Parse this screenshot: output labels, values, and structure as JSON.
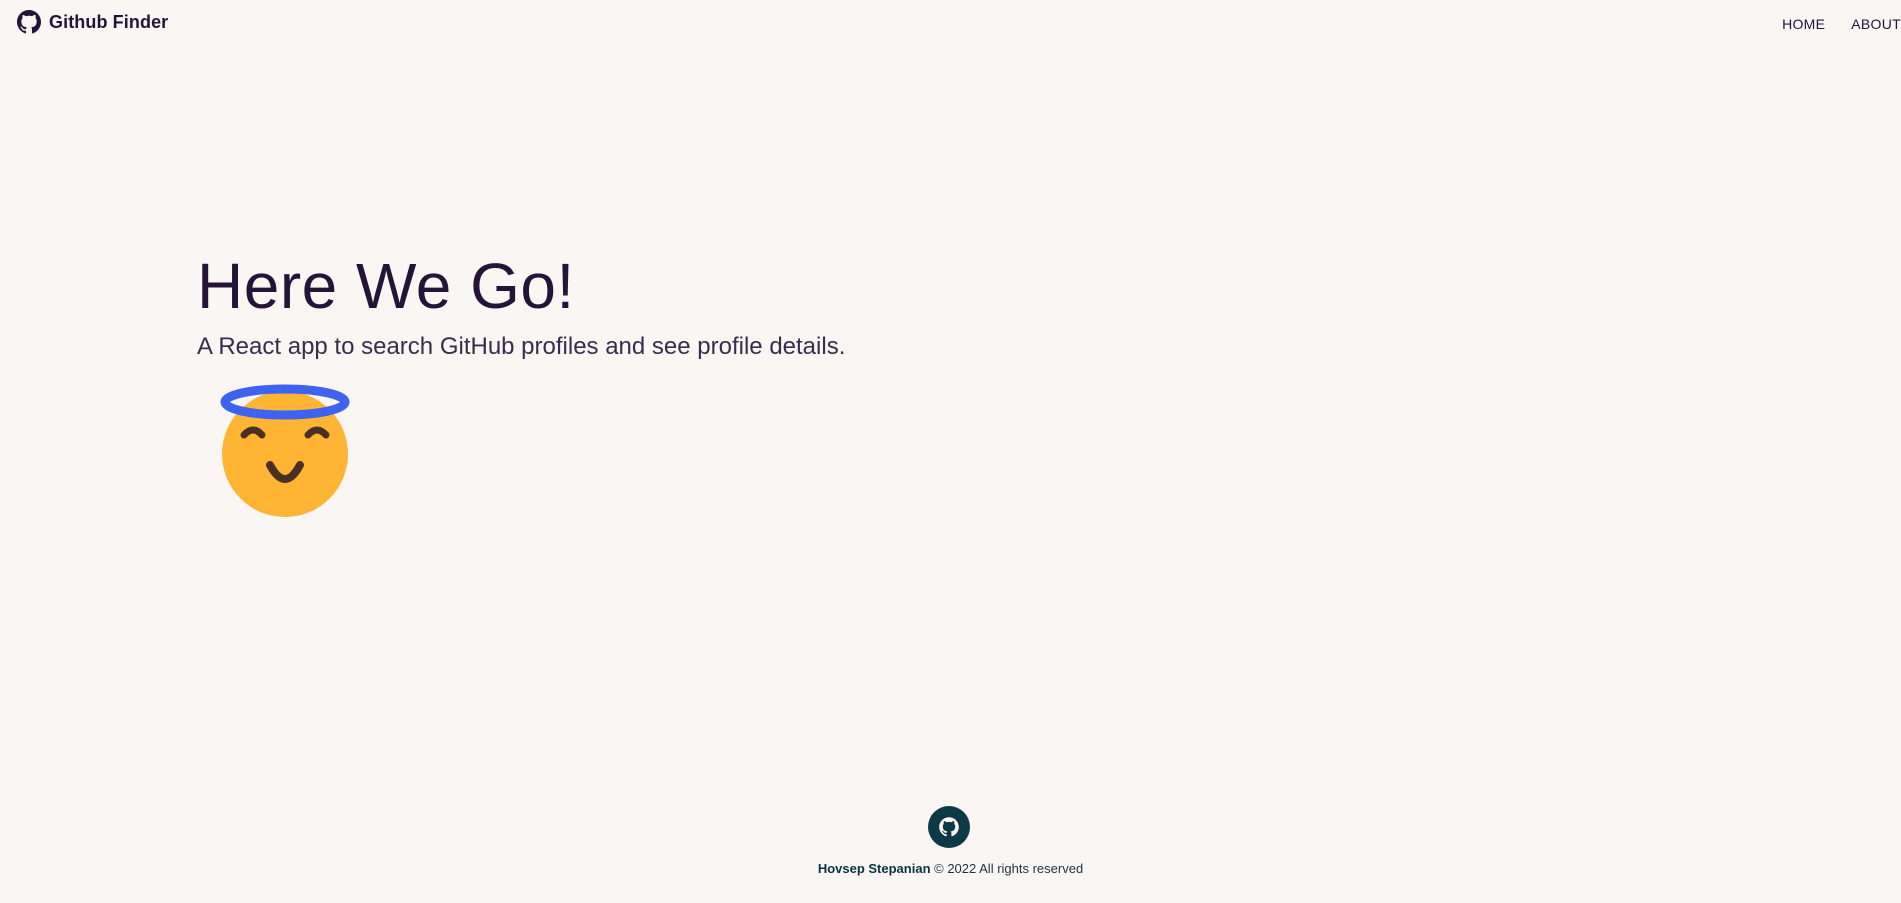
{
  "navbar": {
    "brand_icon": "github-icon",
    "brand_title": "Github Finder",
    "links": [
      {
        "label": "HOME"
      },
      {
        "label": "ABOUT"
      }
    ]
  },
  "hero": {
    "title": "Here We Go!",
    "subtitle": "A React app to search GitHub profiles and see profile details.",
    "emoji_icon": "smiling-face-with-halo-icon"
  },
  "footer": {
    "icon": "github-icon",
    "author": "Hovsep Stepanian",
    "copyright": " © 2022 All rights reserved"
  },
  "colors": {
    "background": "#faf6f3",
    "text": "#241538",
    "footer_icon": "#0b3a46",
    "emoji_face": "#ffb433",
    "emoji_halo": "#3d63f0",
    "emoji_features": "#4a2f25"
  }
}
